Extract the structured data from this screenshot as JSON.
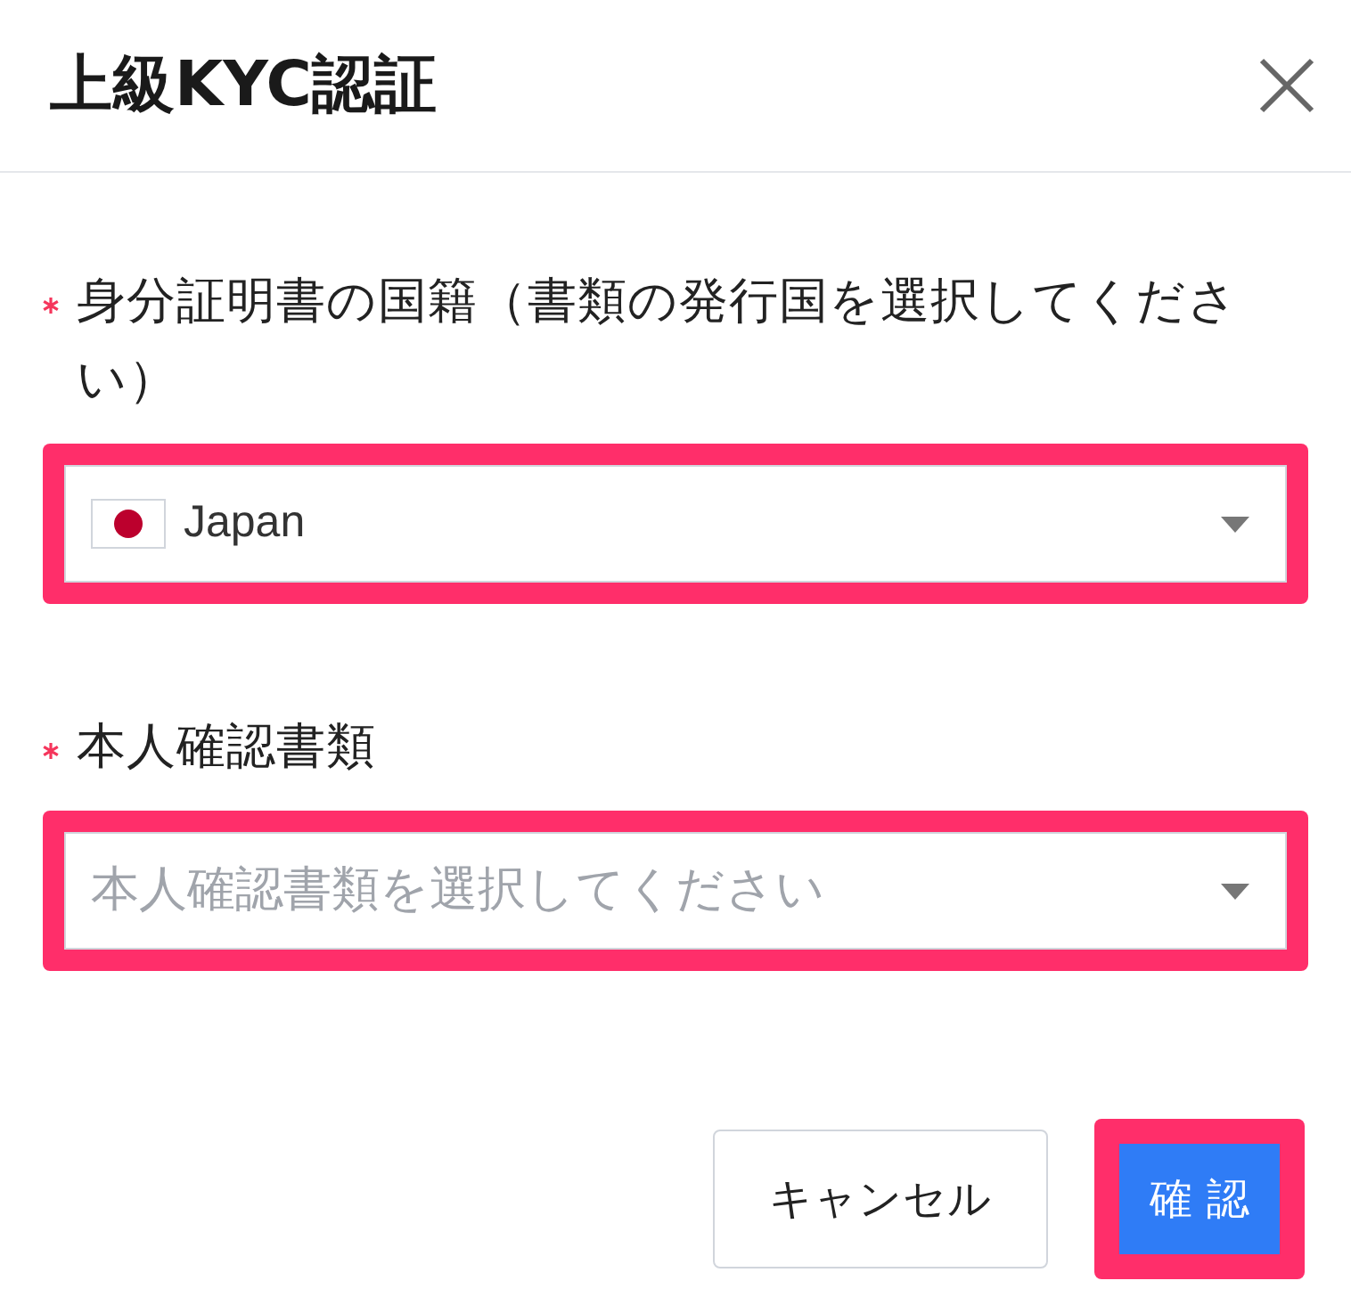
{
  "dialog": {
    "title": "上級KYC認証"
  },
  "fields": [
    {
      "kind": "country",
      "label": "身分証明書の国籍（書類の発行国を選択してください）",
      "required": true,
      "value": "Japan",
      "highlighted": true
    },
    {
      "kind": "select",
      "label": "本人確認書類",
      "required": true,
      "placeholder": "本人確認書類を選択してください",
      "highlighted": true
    }
  ],
  "buttons": [
    {
      "label": "キャンセル",
      "kind": "secondary",
      "highlighted": false
    },
    {
      "label": "確 認",
      "kind": "primary",
      "highlighted": true
    }
  ]
}
